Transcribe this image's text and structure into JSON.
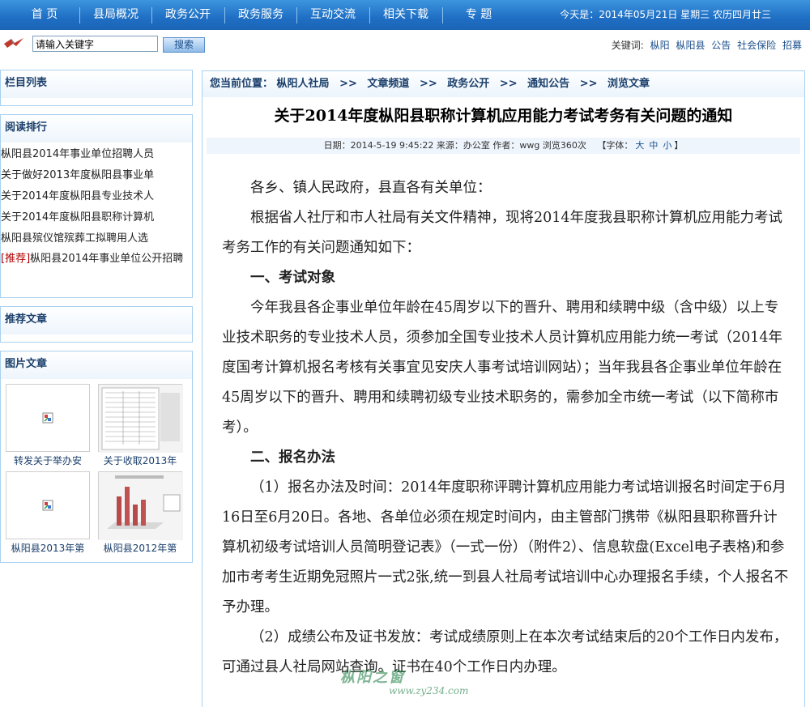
{
  "nav": {
    "items": [
      "首 页",
      "县局概况",
      "政务公开",
      "政务服务",
      "互动交流",
      "相关下载",
      "专  题"
    ],
    "date": "今天是：2014年05月21日 星期三 农历四月廿三"
  },
  "search": {
    "value": "请输入关键字",
    "button": "搜索"
  },
  "keywords": {
    "label": "关键词:",
    "items": [
      "枞阳",
      "枞阳县",
      "公告",
      "社会保险",
      "招募"
    ]
  },
  "sidebar": {
    "column_list_title": "栏目列表",
    "reading_rank_title": "阅读排行",
    "reading_rank": [
      "枞阳县2014年事业单位招聘人员",
      "关于做好2013年度枞阳县事业单",
      "关于2014年度枞阳县专业技术人",
      "关于2014年度枞阳县职称计算机",
      "枞阳县殡仪馆殡葬工拟聘用人选"
    ],
    "recommend_tag": "[推荐]",
    "recommend_item": "枞阳县2014年事业单位公开招聘",
    "recommend_title": "推荐文章",
    "picture_title": "图片文章",
    "pictures": [
      "转发关于举办安",
      "关于收取2013年",
      "枞阳县2013年第",
      "枞阳县2012年第"
    ]
  },
  "article": {
    "breadcrumb_label": "您当前位置：",
    "breadcrumb": [
      "枞阳人社局",
      "文章频道",
      "政务公开",
      "通知公告",
      "浏览文章"
    ],
    "breadcrumb_sep": ">>",
    "title": "关于2014年度枞阳县职称计算机应用能力考试考务有关问题的通知",
    "meta": "日期：2014-5-19 9:45:22 来源：办公室 作者：wwg 浏览360次",
    "font_label": "【字体：",
    "font_sizes": [
      "大",
      "中",
      "小"
    ],
    "font_end": "】",
    "greeting": "各乡、镇人民政府，县直各有关单位：",
    "para1": "根据省人社厅和市人社局有关文件精神，现将2014年度我县职称计算机应用能力考试考务工作的有关问题通知如下：",
    "heading1": "一、考试对象",
    "para2": "今年我县各企事业单位年龄在45周岁以下的晋升、聘用和续聘中级（含中级）以上专业技术职务的专业技术人员，须参加全国专业技术人员计算机应用能力统一考试（2014年度国考计算机报名考核有关事宜见安庆人事考试培训网站）；当年我县各企事业单位年龄在45周岁以下的晋升、聘用和续聘初级专业技术职务的，需参加全市统一考试（以下简称市考）。",
    "heading2": "二、报名办法",
    "para3": "（1）报名办法及时间：2014年度职称评聘计算机应用能力考试培训报名时间定于6月16日至6月20日。各地、各单位必须在规定时间内，由主管部门携带《枞阳县职称晋升计算机初级考试培训人员简明登记表》（一式一份）（附件2）、信息软盘(Excel电子表格)和参加市考考生近期免冠照片一式2张,统一到县人社局考试培训中心办理报名手续，个人报名不予办理。",
    "para4": "（2）成绩公布及证书发放：考试成绩原则上在本次考试结束后的20个工作日内发布，可通过县人社局网站查询。证书在40个工作日内办理。",
    "watermark": "枞阳之窗",
    "watermark_url": "www.zy234.com"
  },
  "colors": {
    "nav": "#1f6fc4",
    "border": "#a9d0ef",
    "heading": "#1b3f6b",
    "tag": "#b00000"
  }
}
